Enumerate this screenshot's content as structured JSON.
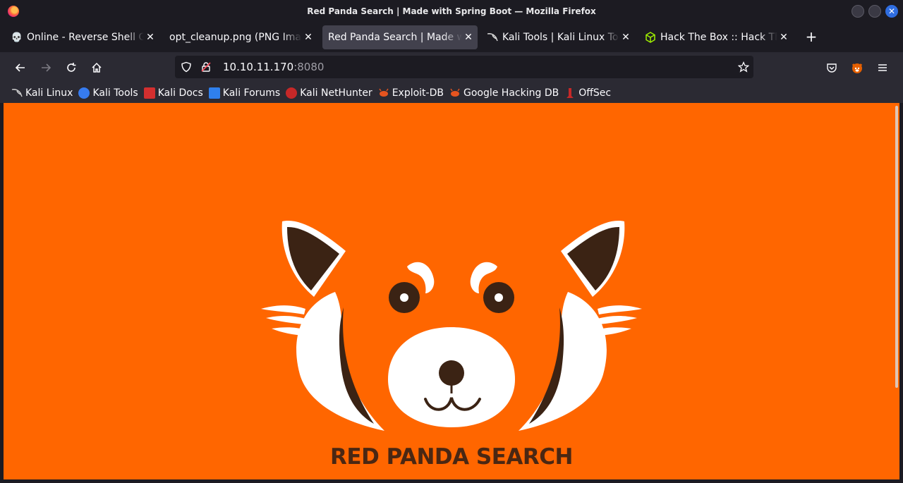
{
  "window": {
    "title": "Red Panda Search | Made with Spring Boot — Mozilla Firefox"
  },
  "tabs": [
    {
      "label": "Online - Reverse Shell Generator",
      "icon": "skull-icon"
    },
    {
      "label": "opt_cleanup.png (PNG Image",
      "icon": ""
    },
    {
      "label": "Red Panda Search | Made with Spring Boot",
      "icon": "",
      "active": true
    },
    {
      "label": "Kali Tools | Kali Linux Tools",
      "icon": "kali-icon"
    },
    {
      "label": "Hack The Box :: Hack The Box",
      "icon": "htb-cube-icon"
    }
  ],
  "url": {
    "host": "10.10.11.170",
    "port": ":8080"
  },
  "bookmarks": [
    {
      "label": "Kali Linux",
      "color": "#1b1b1b"
    },
    {
      "label": "Kali Tools",
      "color": "#367bf0"
    },
    {
      "label": "Kali Docs",
      "color": "#d32f2f"
    },
    {
      "label": "Kali Forums",
      "color": "#2f80ed"
    },
    {
      "label": "Kali NetHunter",
      "color": "#c62828"
    },
    {
      "label": "Exploit-DB",
      "color": "#e6541f"
    },
    {
      "label": "Google Hacking DB",
      "color": "#e6541f"
    },
    {
      "label": "OffSec",
      "color": "#c62828"
    }
  ],
  "page": {
    "heading": "RED PANDA SEARCH",
    "background": "#ff6600"
  }
}
